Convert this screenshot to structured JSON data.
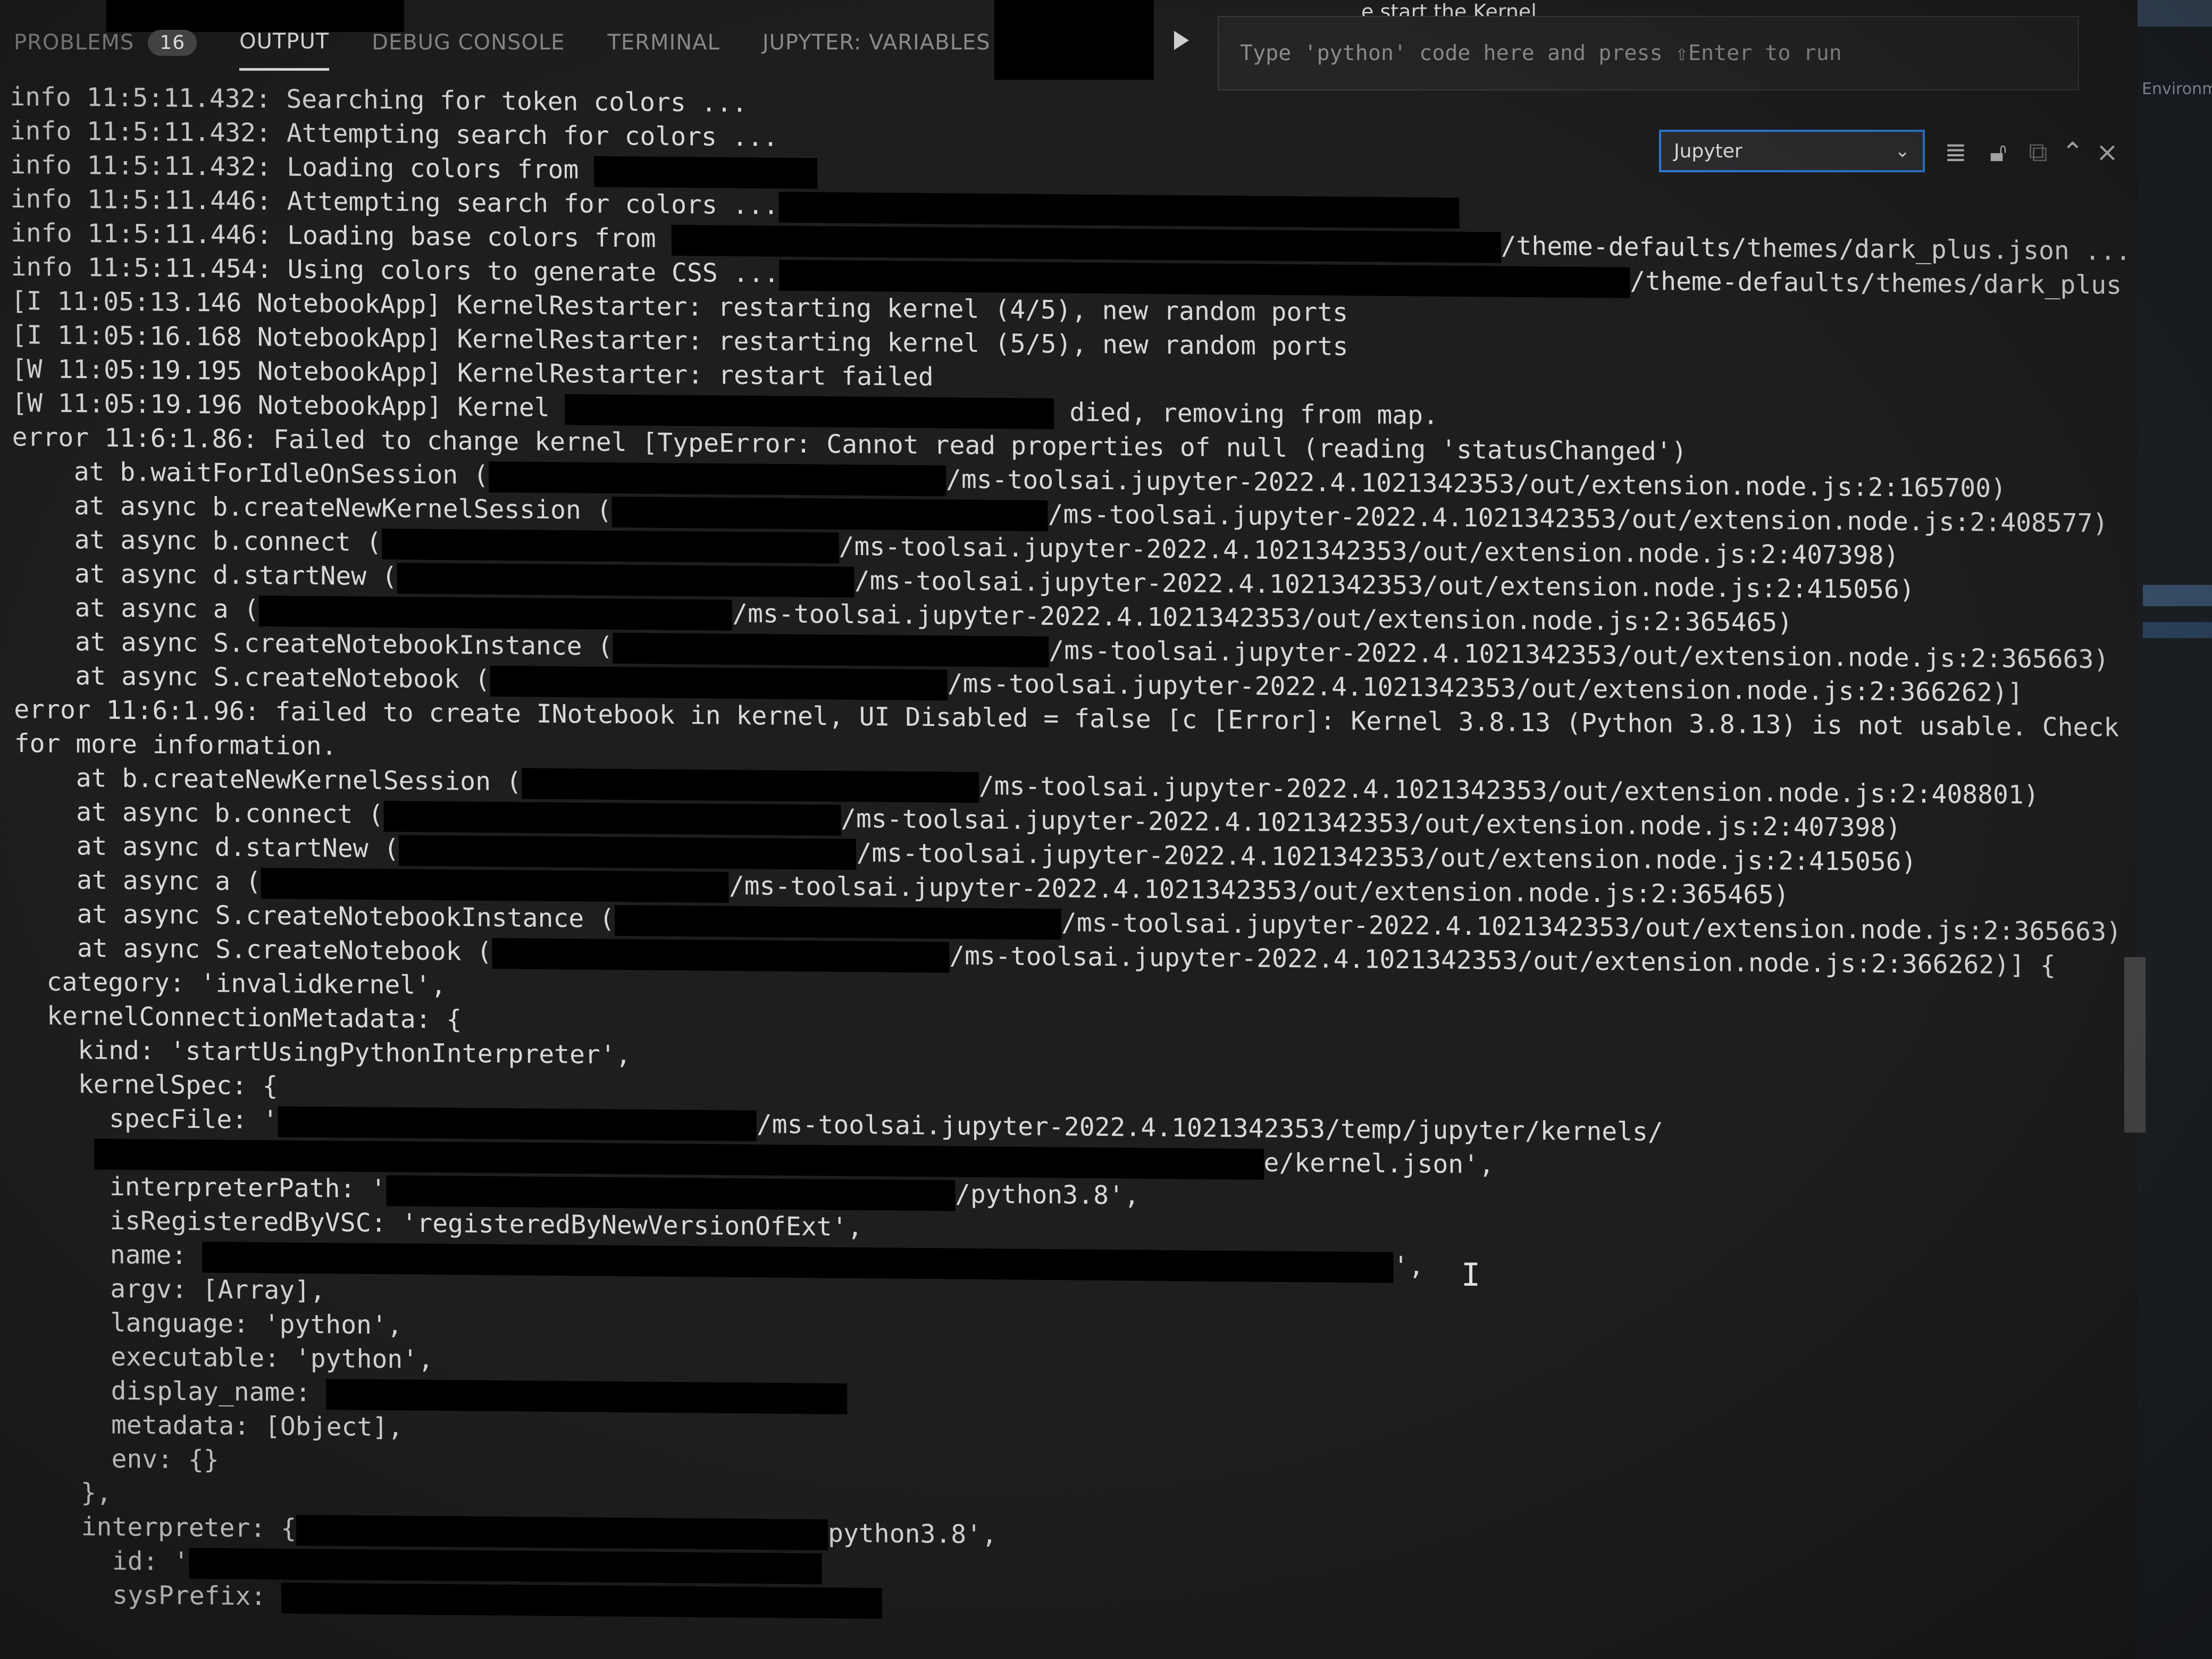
{
  "panel": {
    "tabs": [
      {
        "label": "PROBLEMS",
        "badge": "16"
      },
      {
        "label": "OUTPUT"
      },
      {
        "label": "DEBUG CONSOLE"
      },
      {
        "label": "TERMINAL"
      },
      {
        "label": "JUPYTER: VARIABLES"
      }
    ]
  },
  "interactive": {
    "status_fragment": "e start the Kernel.",
    "input_placeholder": "Type 'python' code here and press ⇧Enter to run"
  },
  "output_toolbar": {
    "channel": "Jupyter",
    "tools": [
      "clear-output",
      "lock",
      "copy",
      "maximize",
      "close"
    ]
  },
  "sidebar": {
    "label": "Environm"
  },
  "log": {
    "lines": [
      {
        "t": "info 11:5:11.432: Searching for token colors ..."
      },
      {
        "t": "info 11:5:11.432: Attempting search for colors ..."
      },
      {
        "t": "info 11:5:11.432: Loading colors from "
      },
      {
        "t": "info 11:5:11.446: Attempting search for colors ..."
      },
      {
        "t": "info 11:5:11.446: Loading base colors from ",
        "t2": "/theme-defaults/themes/dark_plus.json ..."
      },
      {
        "t": "info 11:5:11.454: Using colors to generate CSS ...",
        "t2": "/theme-defaults/themes/dark_plus.json ..."
      },
      {
        "t": "[I 11:05:13.146 NotebookApp] KernelRestarter: restarting kernel (4/5), new random ports"
      },
      {
        "t": "[I 11:05:16.168 NotebookApp] KernelRestarter: restarting kernel (5/5), new random ports"
      },
      {
        "t": "[W 11:05:19.195 NotebookApp] KernelRestarter: restart failed"
      },
      {
        "t": "[W 11:05:19.196 NotebookApp] Kernel ",
        "t2": " died, removing from map."
      },
      {
        "t": "error 11:6:1.86: Failed to change kernel [TypeError: Cannot read properties of null (reading 'statusChanged')"
      },
      {
        "t": "    at b.waitForIdleOnSession (",
        "t2": "/ms-toolsai.jupyter-2022.4.1021342353/out/extension.node.js:2:165700)"
      },
      {
        "t": "    at async b.createNewKernelSession (",
        "t2": "/ms-toolsai.jupyter-2022.4.1021342353/out/extension.node.js:2:408577)"
      },
      {
        "t": "    at async b.connect (",
        "t2": "/ms-toolsai.jupyter-2022.4.1021342353/out/extension.node.js:2:407398)"
      },
      {
        "t": "    at async d.startNew (",
        "t2": "/ms-toolsai.jupyter-2022.4.1021342353/out/extension.node.js:2:415056)"
      },
      {
        "t": "    at async a (",
        "t2": "/ms-toolsai.jupyter-2022.4.1021342353/out/extension.node.js:2:365465)"
      },
      {
        "t": "    at async S.createNotebookInstance (",
        "t2": "/ms-toolsai.jupyter-2022.4.1021342353/out/extension.node.js:2:365663)"
      },
      {
        "t": "    at async S.createNotebook (",
        "t2": "/ms-toolsai.jupyter-2022.4.1021342353/out/extension.node.js:2:366262)]"
      },
      {
        "t": "error 11:6:1.96: failed to create INotebook in kernel, UI Disabled = false [c [Error]: Kernel 3.8.13 (Python 3.8.13) is not usable. Check the Jupyter output tab"
      },
      {
        "t": "for more information."
      },
      {
        "t": "    at b.createNewKernelSession (",
        "t2": "/ms-toolsai.jupyter-2022.4.1021342353/out/extension.node.js:2:408801)"
      },
      {
        "t": "    at async b.connect (",
        "t2": "/ms-toolsai.jupyter-2022.4.1021342353/out/extension.node.js:2:407398)"
      },
      {
        "t": "    at async d.startNew (",
        "t2": "/ms-toolsai.jupyter-2022.4.1021342353/out/extension.node.js:2:415056)"
      },
      {
        "t": "    at async a (",
        "t2": "/ms-toolsai.jupyter-2022.4.1021342353/out/extension.node.js:2:365465)"
      },
      {
        "t": "    at async S.createNotebookInstance (",
        "t2": "/ms-toolsai.jupyter-2022.4.1021342353/out/extension.node.js:2:365663)"
      },
      {
        "t": "    at async S.createNotebook (",
        "t2": "/ms-toolsai.jupyter-2022.4.1021342353/out/extension.node.js:2:366262)] {"
      },
      {
        "t": "  category: 'invalidkernel',"
      },
      {
        "t": "  kernelConnectionMetadata: {"
      },
      {
        "t": "    kind: 'startUsingPythonInterpreter',"
      },
      {
        "t": "    kernelSpec: {"
      },
      {
        "t": "      specFile: '",
        "t2": "/ms-toolsai.jupyter-2022.4.1021342353/temp/jupyter/kernels/"
      },
      {
        "t": "     ",
        "t2": "e/kernel.json',"
      },
      {
        "t": "      interpreterPath: '",
        "t2": "/python3.8',"
      },
      {
        "t": "      isRegisteredByVSC: 'registeredByNewVersionOfExt',"
      },
      {
        "t": "      name: ",
        "t2": "',"
      },
      {
        "t": "      argv: [Array],"
      },
      {
        "t": "      language: 'python',"
      },
      {
        "t": "      executable: 'python',"
      },
      {
        "t": "      display_name: "
      },
      {
        "t": "      metadata: [Object],"
      },
      {
        "t": "      env: {}"
      },
      {
        "t": "    },"
      },
      {
        "t": "    interpreter: {",
        "t2": "python3.8',"
      },
      {
        "t": "      id: '"
      },
      {
        "t": "      sysPrefix: "
      }
    ]
  }
}
